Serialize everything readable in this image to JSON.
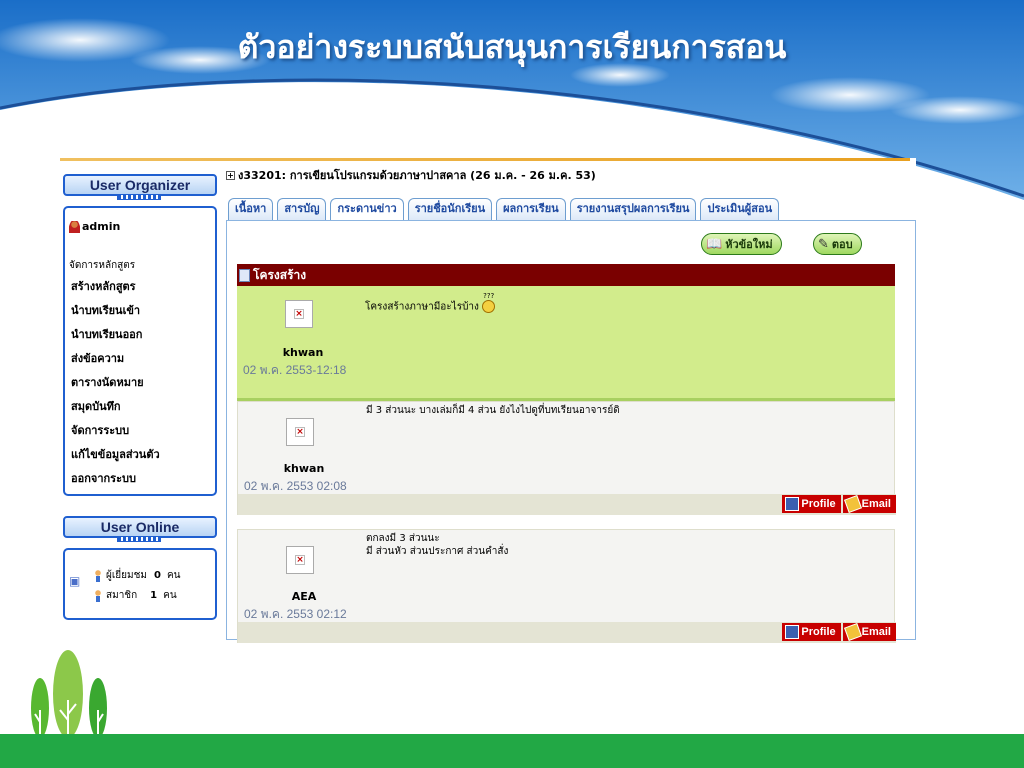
{
  "slide": {
    "title": "ตัวอย่างระบบสนับสนุนการเรียนการสอน"
  },
  "sidebar": {
    "organizer_title": "User Organizer",
    "user": "admin",
    "menu_heading": "จัดการหลักสูตร",
    "menu_items": [
      "สร้างหลักสูตร",
      "นำบทเรียนเข้า",
      "นำบทเรียนออก",
      "ส่งข้อความ",
      "ตารางนัดหมาย",
      "สมุดบันทึก",
      "จัดการระบบ",
      "แก้ไขข้อมูลส่วนตัว",
      "ออกจากระบบ"
    ],
    "online_title": "User Online",
    "online": {
      "guest_label": "ผู้เยี่ยมชม",
      "guest_count": "0",
      "guest_unit": "คน",
      "member_label": "สมาชิก",
      "member_count": "1",
      "member_unit": "คน"
    }
  },
  "course": {
    "title": "ง33201: การเขียนโปรแกรมด้วยภาษาปาสคาล (26 ม.ค. - 26 ม.ค. 53)",
    "tabs": [
      "เนื้อหา",
      "สารบัญ",
      "กระดานข่าว",
      "รายชื่อนักเรียน",
      "ผลการเรียน",
      "รายงานสรุปผลการเรียน",
      "ประเมินผู้สอน"
    ],
    "active_tab": 2
  },
  "board": {
    "new_topic_label": "หัวข้อใหม่",
    "reply_label": "ตอบ",
    "topic_title": "โครงสร้าง",
    "posts": [
      {
        "user": "khwan",
        "date": "02 พ.ค. 2553-12:18",
        "text": "โครงสร้างภาษามีอะไรบ้าง",
        "emote": "???"
      },
      {
        "user": "khwan",
        "date": "02 พ.ค. 2553 02:08",
        "text": "มี 3 ส่วนนะ บางเล่มก็มี 4 ส่วน ยังไงไปดูที่บทเรียนอาจารย์ดิ"
      },
      {
        "user": "AEA",
        "date": "02 พ.ค. 2553 02:12",
        "text_line1": "ตกลงมี 3 ส่วนนะ",
        "text_line2": "มี ส่วนหัว ส่วนประกาศ ส่วนคำสั่ง"
      }
    ],
    "profile_label": "Profile",
    "email_label": "Email"
  },
  "colors": {
    "topic_header": "#7a0000",
    "first_post_bg": "#d2ec8c",
    "post_bg": "#f4f4f2",
    "post_bar": "#e4e4d4",
    "footer_green": "#22a845"
  }
}
